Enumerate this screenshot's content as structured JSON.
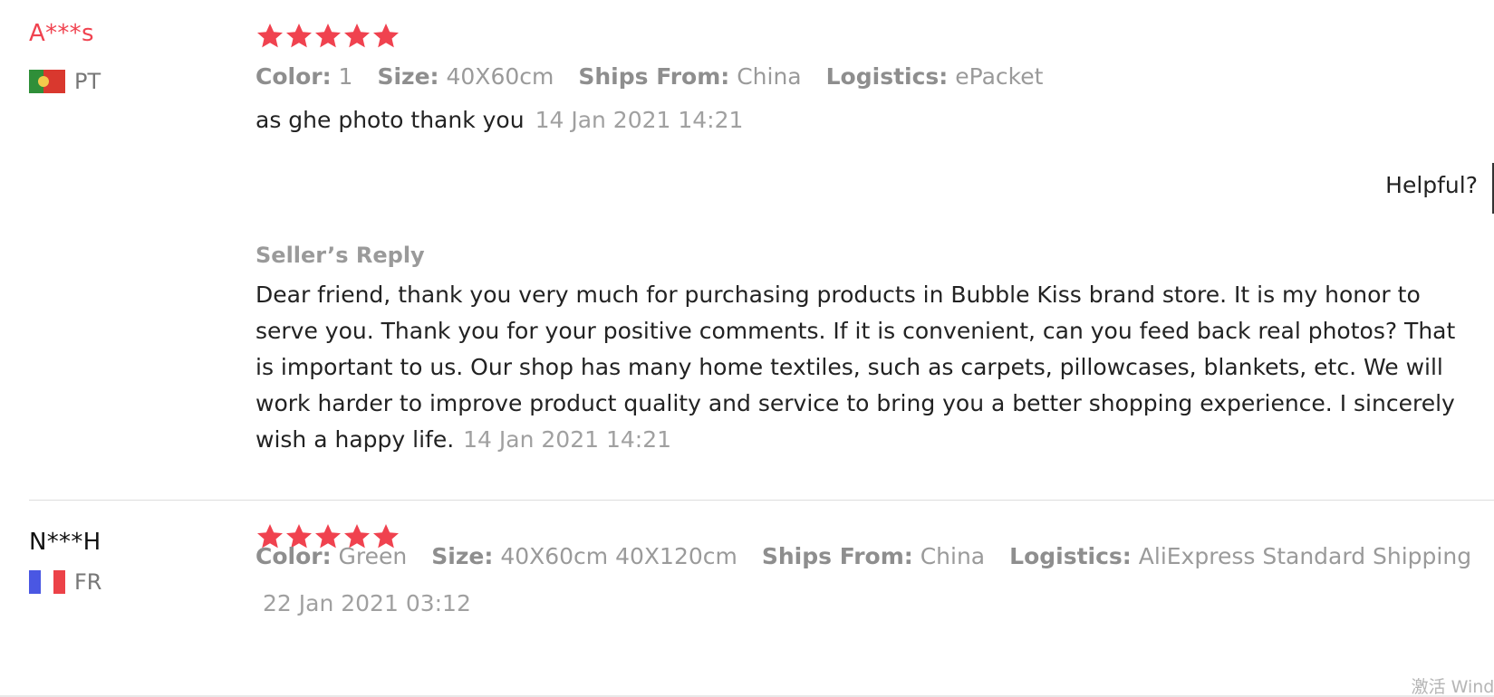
{
  "colors": {
    "accent_red": "#f0424f",
    "text_dark": "#222222",
    "text_gray": "#9a9a9a"
  },
  "reviews": [
    {
      "user": "A***s",
      "country": "PT",
      "stars": 5,
      "meta": {
        "color_label": "Color:",
        "color_value": "1",
        "size_label": "Size:",
        "size_value": "40X60cm",
        "ships_label": "Ships From:",
        "ships_value": "China",
        "logistics_label": "Logistics:",
        "logistics_value": "ePacket"
      },
      "text": "as ghe photo thank you",
      "date": "14 Jan 2021 14:21",
      "helpful_label": "Helpful?",
      "seller_reply": {
        "title": "Seller’s Reply",
        "text": "Dear friend, thank you very much for purchasing products in Bubble Kiss brand store. It is my honor to serve you. Thank you for your positive comments. If it is convenient, can you feed back real photos? That is important to us. Our shop has many home textiles, such as carpets, pillowcases, blankets, etc. We will work harder to improve product quality and service to bring you a better shopping experience. I sincerely wish a happy life.",
        "date": "14 Jan 2021 14:21"
      }
    },
    {
      "user": "N***H",
      "country": "FR",
      "stars": 5,
      "meta": {
        "color_label": "Color:",
        "color_value": "Green",
        "size_label": "Size:",
        "size_value": "40X60cm 40X120cm",
        "ships_label": "Ships From:",
        "ships_value": "China",
        "logistics_label": "Logistics:",
        "logistics_value": "AliExpress Standard Shipping"
      },
      "date": "22 Jan 2021 03:12"
    }
  ],
  "watermark": "激活 Windo"
}
